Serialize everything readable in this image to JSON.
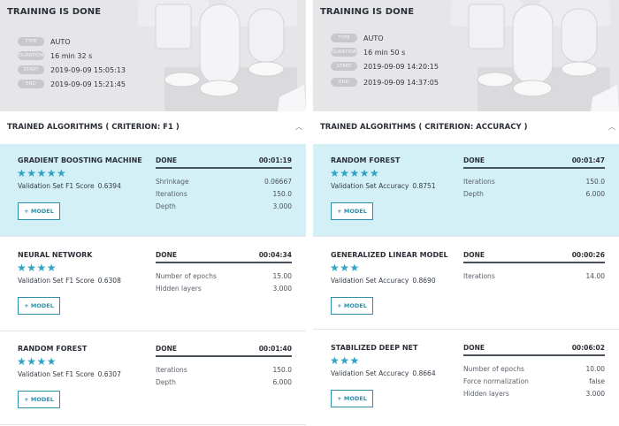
{
  "left": {
    "hero": {
      "title": "TRAINING IS DONE",
      "meta": [
        {
          "badge": "TYPE",
          "value": "AUTO"
        },
        {
          "badge": "DURATION",
          "value": "16 min 32 s"
        },
        {
          "badge": "START",
          "value": "2019-09-09 15:05:13"
        },
        {
          "badge": "END",
          "value": "2019-09-09 15:21:45"
        }
      ]
    },
    "section_title": "TRAINED ALGORITHMS ( CRITERION: F1 )",
    "models": [
      {
        "name": "GRADIENT BOOSTING MACHINE",
        "stars": "★★★★★",
        "score_label": "Validation Set F1 Score",
        "score": "0.6394",
        "button": "+ MODEL",
        "status": "DONE",
        "time": "00:01:19",
        "params": [
          {
            "label": "Shrinkage",
            "value": "0.06667"
          },
          {
            "label": "Iterations",
            "value": "150.0"
          },
          {
            "label": "Depth",
            "value": "3.000"
          }
        ]
      },
      {
        "name": "NEURAL NETWORK",
        "stars": "★★★★",
        "score_label": "Validation Set F1 Score",
        "score": "0.6308",
        "button": "+ MODEL",
        "status": "DONE",
        "time": "00:04:34",
        "params": [
          {
            "label": "Number of epochs",
            "value": "15.00"
          },
          {
            "label": "Hidden layers",
            "value": "3.000"
          }
        ]
      },
      {
        "name": "RANDOM FOREST",
        "stars": "★★★★",
        "score_label": "Validation Set F1 Score",
        "score": "0.6307",
        "button": "+ MODEL",
        "status": "DONE",
        "time": "00:01:40",
        "params": [
          {
            "label": "Iterations",
            "value": "150.0"
          },
          {
            "label": "Depth",
            "value": "6.000"
          }
        ]
      }
    ]
  },
  "right": {
    "hero": {
      "title": "TRAINING IS DONE",
      "meta": [
        {
          "badge": "TYPE",
          "value": "AUTO"
        },
        {
          "badge": "DURATION",
          "value": "16 min 50 s"
        },
        {
          "badge": "START",
          "value": "2019-09-09 14:20:15"
        },
        {
          "badge": "END",
          "value": "2019-09-09 14:37:05"
        }
      ]
    },
    "section_title": "TRAINED ALGORITHMS ( CRITERION: ACCURACY )",
    "models": [
      {
        "name": "RANDOM FOREST",
        "stars": "★★★★★",
        "score_label": "Validation Set Accuracy",
        "score": "0.8751",
        "button": "+ MODEL",
        "status": "DONE",
        "time": "00:01:47",
        "params": [
          {
            "label": "Iterations",
            "value": "150.0"
          },
          {
            "label": "Depth",
            "value": "6.000"
          }
        ]
      },
      {
        "name": "GENERALIZED LINEAR MODEL",
        "stars": "★★★",
        "score_label": "Validation Set Accuracy",
        "score": "0.8690",
        "button": "+ MODEL",
        "status": "DONE",
        "time": "00:00:26",
        "params": [
          {
            "label": "Iterations",
            "value": "14.00"
          }
        ]
      },
      {
        "name": "STABILIZED DEEP NET",
        "stars": "★★★",
        "score_label": "Validation Set Accuracy",
        "score": "0.8664",
        "button": "+ MODEL",
        "status": "DONE",
        "time": "00:06:02",
        "params": [
          {
            "label": "Number of epochs",
            "value": "10.00"
          },
          {
            "label": "Force normalization",
            "value": "false"
          },
          {
            "label": "Hidden layers",
            "value": "3.000"
          }
        ]
      }
    ]
  },
  "colors": {
    "accent": "#2e8fab",
    "highlight_bg": "#d3f0f6",
    "star": "#2fa3c3",
    "hero_bg": "#e6e6e8"
  },
  "icons": {
    "collapse": "chevron-up-icon",
    "rating": "star-icon"
  }
}
